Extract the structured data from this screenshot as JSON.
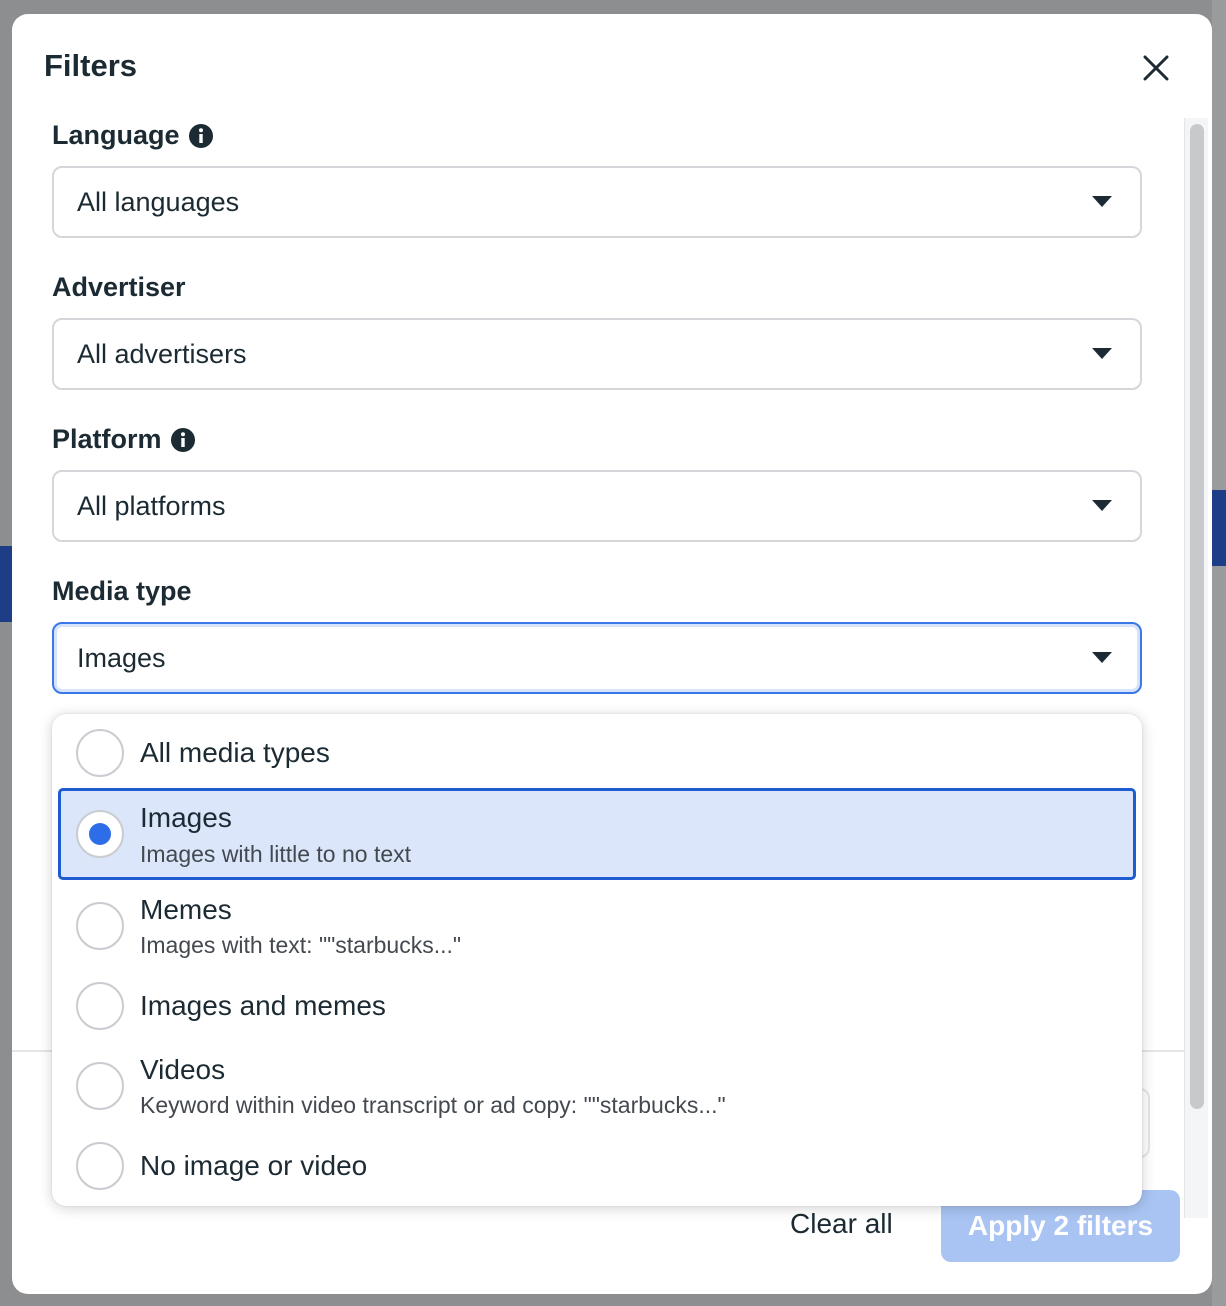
{
  "modal": {
    "title": "Filters",
    "fields": {
      "language": {
        "label": "Language",
        "value": "All languages"
      },
      "advertiser": {
        "label": "Advertiser",
        "value": "All advertisers"
      },
      "platform": {
        "label": "Platform",
        "value": "All platforms"
      },
      "media_type": {
        "label": "Media type",
        "value": "Images"
      }
    },
    "menu": {
      "options": [
        {
          "title": "All media types",
          "subtitle": "",
          "selected": false
        },
        {
          "title": "Images",
          "subtitle": "Images with little to no text",
          "selected": true
        },
        {
          "title": "Memes",
          "subtitle": "Images with text: \"\"starbucks...\"",
          "selected": false
        },
        {
          "title": "Images and memes",
          "subtitle": "",
          "selected": false
        },
        {
          "title": "Videos",
          "subtitle": "Keyword within video transcript or ad copy: \"\"starbucks...\"",
          "selected": false
        },
        {
          "title": "No image or video",
          "subtitle": "",
          "selected": false
        }
      ]
    },
    "footer": {
      "clear_label": "Clear all",
      "apply_label": "Apply 2 filters"
    }
  },
  "colors": {
    "accent": "#1f5bd1",
    "selected_bg": "#dbe6fb",
    "apply_disabled": "#a9c4f3"
  }
}
